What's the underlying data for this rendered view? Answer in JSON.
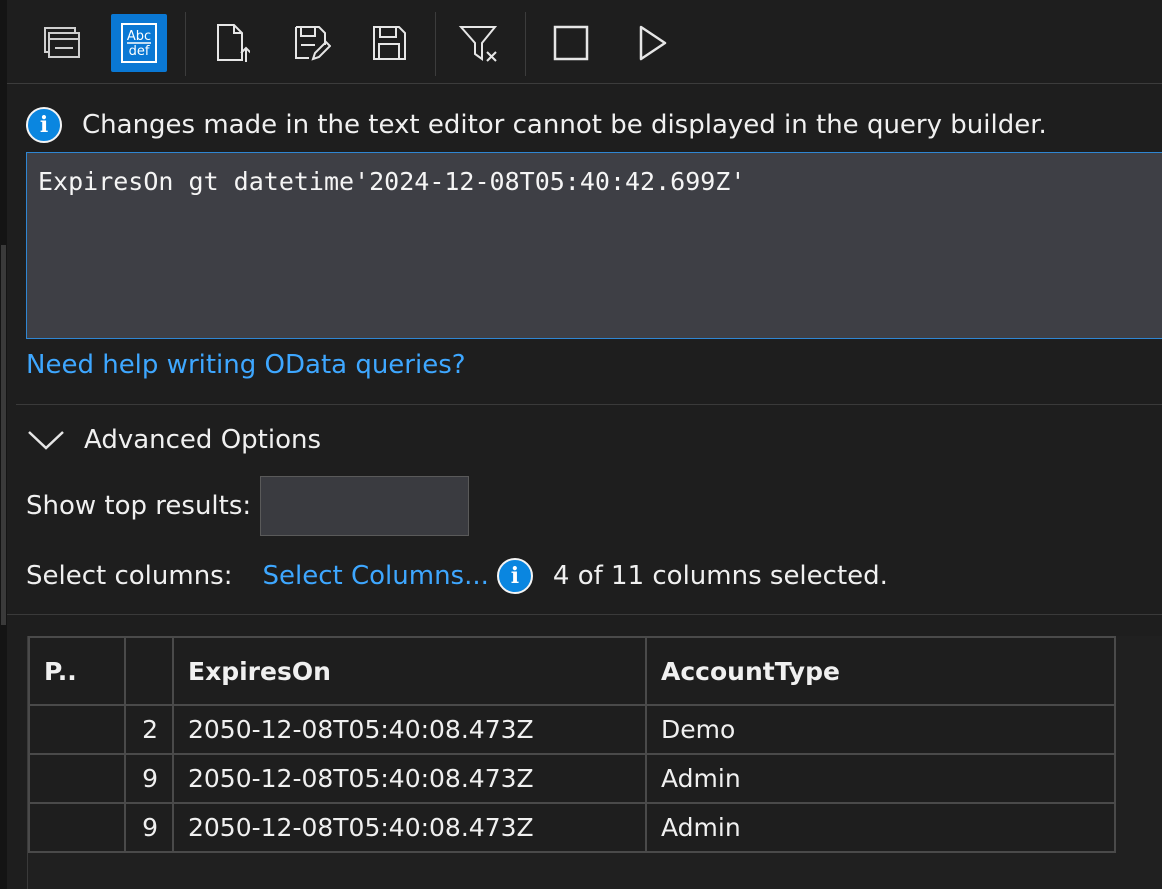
{
  "toolbar": {
    "buttons": [
      {
        "name": "window-layout",
        "active": false
      },
      {
        "name": "text-editor-toggle",
        "active": true,
        "icon_text_top": "Abc",
        "icon_text_bottom": "def"
      },
      {
        "name": "open-query",
        "active": false
      },
      {
        "name": "edit-query",
        "active": false
      },
      {
        "name": "save-query",
        "active": false
      },
      {
        "name": "clear-filter",
        "active": false
      },
      {
        "name": "stop",
        "active": false
      },
      {
        "name": "run-query",
        "active": false
      }
    ]
  },
  "info": {
    "icon": "i",
    "message": "Changes made in the text editor cannot be displayed in the query builder."
  },
  "editor": {
    "query": "ExpiresOn gt datetime'2024-12-08T05:40:42.699Z'"
  },
  "help": {
    "link": "Need help writing OData queries?"
  },
  "advanced": {
    "label": "Advanced Options",
    "expanded": true,
    "show_top_label": "Show top results:",
    "show_top_value": "",
    "select_columns_label": "Select columns:",
    "select_columns_link": "Select Columns...",
    "columns_info_icon": "i",
    "columns_selected": "4 of 11 columns selected."
  },
  "results": {
    "headers": [
      "P..",
      "",
      "ExpiresOn",
      "AccountType"
    ],
    "rows": [
      {
        "p": "",
        "num": "2",
        "expires": "2050-12-08T05:40:08.473Z",
        "account": "Demo"
      },
      {
        "p": "",
        "num": "9",
        "expires": "2050-12-08T05:40:08.473Z",
        "account": "Admin"
      },
      {
        "p": "",
        "num": "9",
        "expires": "2050-12-08T05:40:08.473Z",
        "account": "Admin"
      }
    ]
  },
  "colors": {
    "background": "#1e1e1e",
    "accent": "#0a78d4",
    "link": "#3ea7ff",
    "editor_bg": "#3e3f45"
  }
}
